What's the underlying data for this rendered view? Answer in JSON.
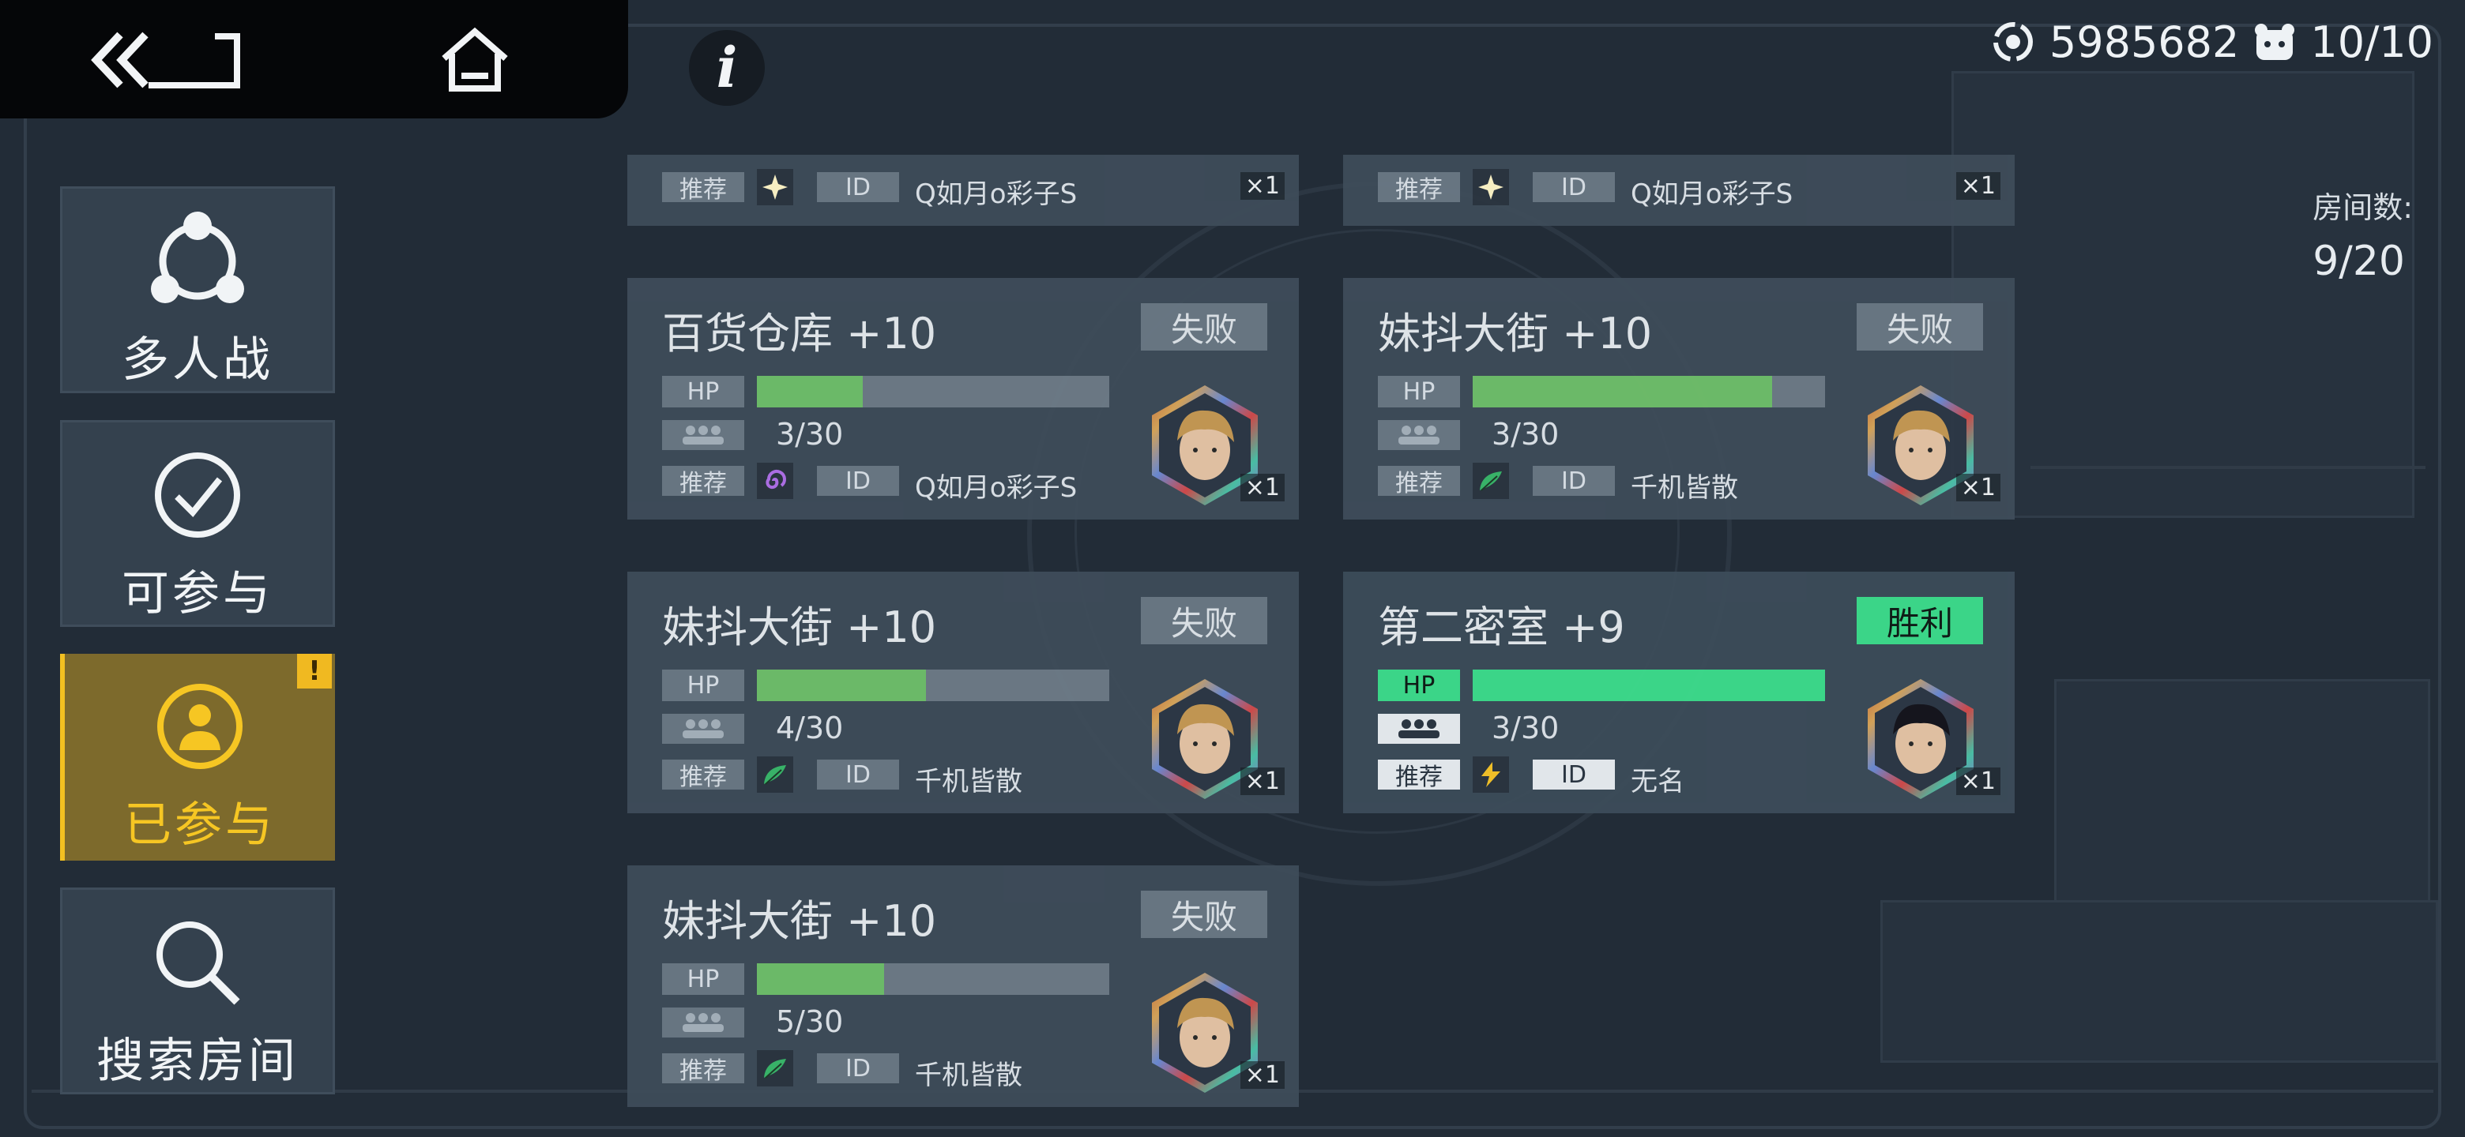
{
  "header": {
    "currency_value": "5985682",
    "stamina": "10/10",
    "room_count_label": "房间数:",
    "room_count_value": "9/20"
  },
  "sidebar": {
    "items": [
      {
        "label": "多人战",
        "icon": "network-icon",
        "active": false
      },
      {
        "label": "可参与",
        "icon": "check-circle-icon",
        "active": false
      },
      {
        "label": "已参与",
        "icon": "user-icon",
        "active": true,
        "badge": "!"
      },
      {
        "label": "搜索房间",
        "icon": "search-icon",
        "active": false
      }
    ]
  },
  "labels": {
    "recommend": "推荐",
    "id": "ID",
    "hp": "HP"
  },
  "rooms": [
    {
      "title": "",
      "result": "",
      "count": "",
      "owner": "Q如月o彩子S",
      "element": "star",
      "hp": 0,
      "mult": "×1"
    },
    {
      "title": "",
      "result": "",
      "count": "",
      "owner": "Q如月o彩子S",
      "element": "star",
      "hp": 0,
      "mult": "×1"
    },
    {
      "title": "百货仓库 +10",
      "result": "失败",
      "count": "3/30",
      "owner": "Q如月o彩子S",
      "element": "spiral",
      "hp": 0.3,
      "mult": "×1"
    },
    {
      "title": "妹抖大街 +10",
      "result": "失败",
      "count": "3/30",
      "owner": "千机皆散",
      "element": "leaf",
      "hp": 0.85,
      "mult": "×1"
    },
    {
      "title": "妹抖大街 +10",
      "result": "失败",
      "count": "4/30",
      "owner": "千机皆散",
      "element": "leaf",
      "hp": 0.48,
      "mult": "×1"
    },
    {
      "title": "第二密室 +9",
      "result": "胜利",
      "count": "3/30",
      "owner": "无名",
      "element": "bolt",
      "hp": 1.0,
      "mult": "×1"
    },
    {
      "title": "妹抖大街 +10",
      "result": "失败",
      "count": "5/30",
      "owner": "千机皆散",
      "element": "leaf",
      "hp": 0.36,
      "mult": "×1"
    }
  ],
  "colors": {
    "accent": "#f2c021",
    "win": "#3ddc8c",
    "hp_fill": "#6fbf6a"
  }
}
